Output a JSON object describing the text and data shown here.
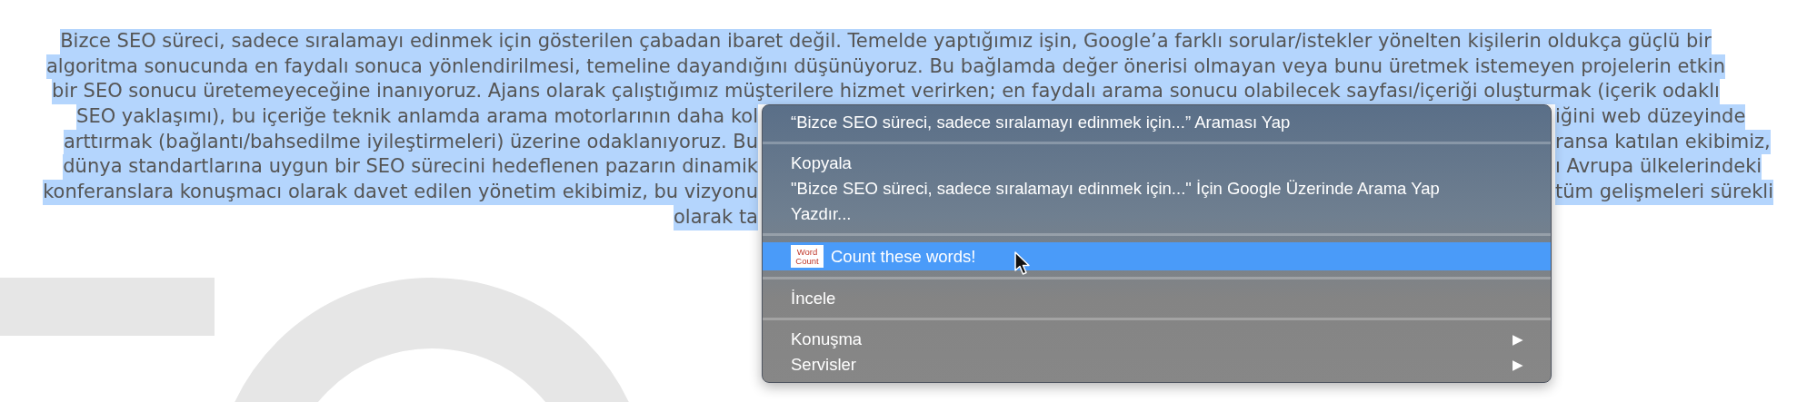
{
  "paragraph": {
    "selected": true,
    "lines": [
      {
        "kind": "full",
        "text": "Bizce SEO süreci, sadece sıralamayı edinmek için gösterilen çabadan ibaret değil. Temelde yaptığımız işin, Google’a farklı sorular/istekler yönelten kişilerin oldukça güçlü bir"
      },
      {
        "kind": "full",
        "text": "algoritma sonucunda en faydalı sonuca yönlendirilmesi, temeline dayandığını düşünüyoruz. Bu bağlamda değer önerisi olmayan veya bunu üretmek istemeyen projelerin etkin"
      },
      {
        "kind": "full",
        "text": "bir SEO sonucu üretemeyeceğine inanıyoruz. Ajans olarak çalıştığımız müşterilere hizmet verirken; en faydalı arama sonucu olabilecek sayfası/içeriği oluşturmak (içerik odaklı"
      },
      {
        "kind": "split",
        "left": "SEO yaklaşımı), bu içeriğe teknik anlamda arama motorlarının daha kol",
        "right": "iğini web düzeyinde"
      },
      {
        "kind": "split",
        "left": "arttırmak (bağlantı/bahsedilme iyileştirmeleri) üzerine odaklanıyoruz. Bu",
        "right": "ransa katılan ekibimiz,"
      },
      {
        "kind": "split",
        "left": "dünya standartlarına uygun bir SEO sürecini hedeflenen pazarın dinamik",
        "right": "ı Avrupa ülkelerindeki"
      },
      {
        "kind": "split",
        "left": "konferanslara konuşmacı olarak davet edilen yönetim ekibimiz, bu vizyonu",
        "right": "tüm gelişmeleri sürekli"
      },
      {
        "kind": "split",
        "left": "olarak ta"
      }
    ]
  },
  "context_menu": {
    "items": [
      {
        "kind": "item",
        "label": "“Bizce SEO süreci, sadece sıralamayı edinmek için...” Araması Yap",
        "selected": false
      },
      {
        "kind": "separator"
      },
      {
        "kind": "item",
        "label": "Kopyala",
        "selected": false
      },
      {
        "kind": "item",
        "label": "\"Bizce SEO süreci, sadece sıralamayı edinmek için...\" İçin Google Üzerinde Arama Yap",
        "selected": false
      },
      {
        "kind": "item",
        "label": "Yazdır...",
        "selected": false
      },
      {
        "kind": "separator"
      },
      {
        "kind": "item",
        "label": "Count these words!",
        "selected": true,
        "icon_text": "Word Count"
      },
      {
        "kind": "separator"
      },
      {
        "kind": "item",
        "label": "İncele",
        "selected": false
      },
      {
        "kind": "separator"
      },
      {
        "kind": "item",
        "label": "Konuşma",
        "selected": false,
        "arrow": "▶"
      },
      {
        "kind": "item",
        "label": "Servisler",
        "selected": false,
        "arrow": "▶"
      }
    ]
  }
}
